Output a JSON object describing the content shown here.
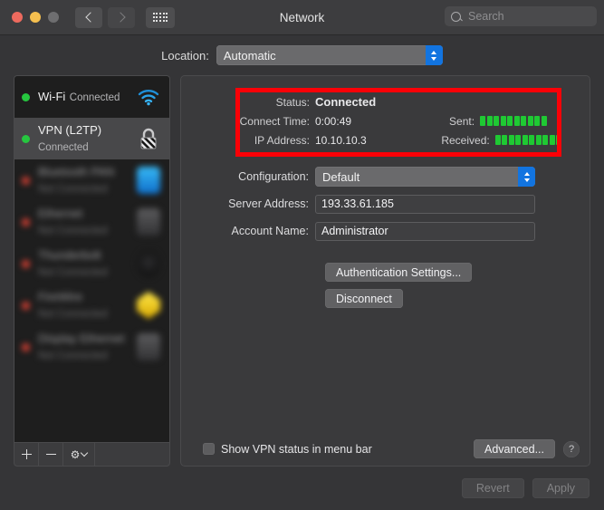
{
  "window": {
    "title": "Network",
    "traffic_lights": [
      "close",
      "minimize",
      "zoom"
    ]
  },
  "toolbar": {
    "back_icon": "chevron-left-icon",
    "forward_icon": "chevron-right-icon",
    "grid_icon": "show-all-preferences-icon",
    "search_placeholder": "Search",
    "search_value": ""
  },
  "location": {
    "label": "Location:",
    "value": "Automatic",
    "options": [
      "Automatic"
    ]
  },
  "sidebar": {
    "services": [
      {
        "name": "Wi-Fi",
        "status": "Connected",
        "dot": "green",
        "icon": "wifi-icon",
        "selected": false,
        "blurred": false
      },
      {
        "name": "VPN (L2TP)",
        "status": "Connected",
        "dot": "green",
        "icon": "lock-icon",
        "selected": true,
        "blurred": false
      },
      {
        "name": "Bluetooth PAN",
        "status": "Not Connected",
        "dot": "red",
        "icon": "bluetooth-icon",
        "selected": false,
        "blurred": true
      },
      {
        "name": "Ethernet",
        "status": "Not Connected",
        "dot": "red",
        "icon": "ethernet-icon",
        "selected": false,
        "blurred": true
      },
      {
        "name": "Thunderbolt",
        "status": "Not Connected",
        "dot": "red",
        "icon": "thunderbolt-icon",
        "selected": false,
        "blurred": true
      },
      {
        "name": "FireWire",
        "status": "Not Connected",
        "dot": "red",
        "icon": "firewire-icon",
        "selected": false,
        "blurred": true
      },
      {
        "name": "Display Ethernet",
        "status": "Not Connected",
        "dot": "red",
        "icon": "display-icon",
        "selected": false,
        "blurred": true
      }
    ],
    "toolbar": {
      "add_label": "+",
      "remove_label": "−",
      "actions_icon": "gear-icon"
    }
  },
  "status_panel": {
    "highlight_color": "#fb0007",
    "rows": [
      {
        "label": "Status:",
        "value": "Connected",
        "bold": true
      }
    ],
    "connect_time": {
      "label": "Connect Time:",
      "value": "0:00:49"
    },
    "ip_address": {
      "label": "IP Address:",
      "value": "10.10.10.3"
    },
    "sent": {
      "label": "Sent:",
      "segments": 10,
      "color": "#1fc933"
    },
    "received": {
      "label": "Received:",
      "segments": 10,
      "color": "#1fc933"
    }
  },
  "form": {
    "configuration": {
      "label": "Configuration:",
      "value": "Default",
      "options": [
        "Default"
      ]
    },
    "server_address": {
      "label": "Server Address:",
      "value": "193.33.61.185"
    },
    "account_name": {
      "label": "Account Name:",
      "value": "Administrator"
    }
  },
  "actions": {
    "authentication_settings": "Authentication Settings...",
    "disconnect": "Disconnect"
  },
  "bottom": {
    "show_vpn_status_label": "Show VPN status in menu bar",
    "show_vpn_status_checked": false,
    "advanced": "Advanced...",
    "help": "?"
  },
  "footer": {
    "revert": "Revert",
    "apply": "Apply"
  }
}
